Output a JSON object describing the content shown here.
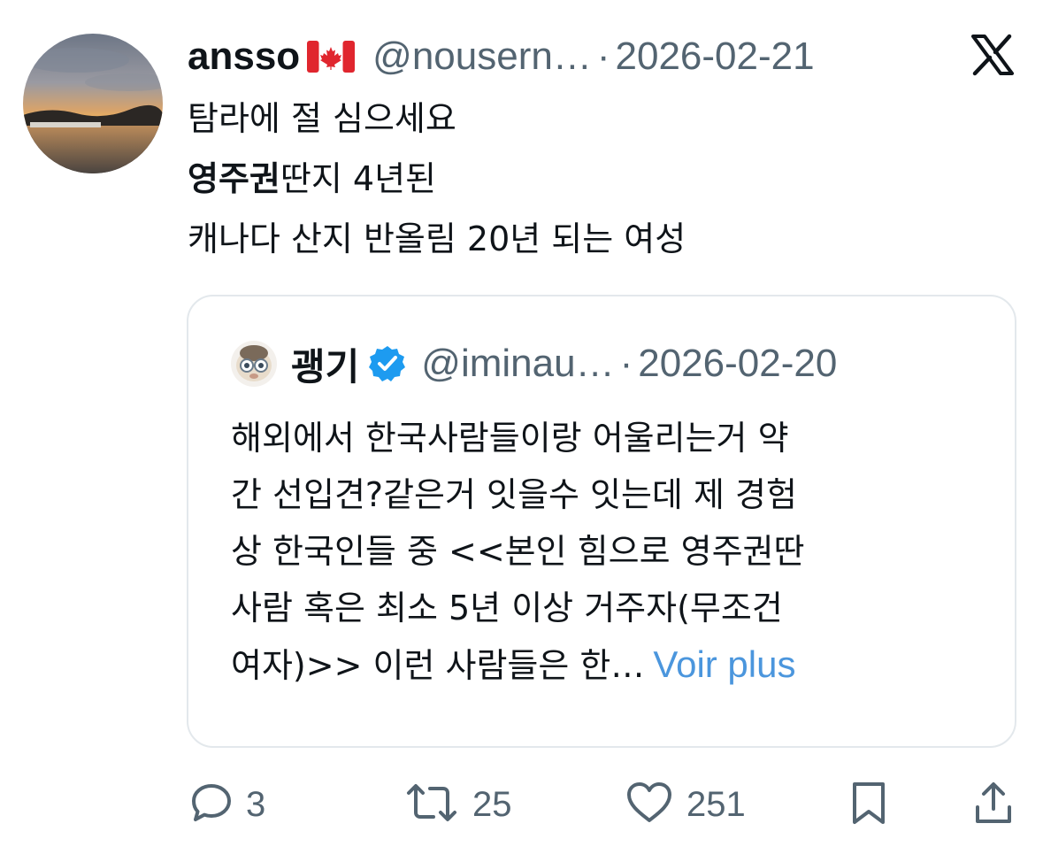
{
  "tweet": {
    "author_name": "ansso",
    "handle": "@nousern…",
    "date": "2026-02-21",
    "separator": "·",
    "flag_icon": "canada-flag-icon",
    "lines": [
      {
        "bold": "",
        "text": "탐라에 절 심으세요"
      },
      {
        "bold": "영주권",
        "text": "딴지 4년된"
      },
      {
        "bold": "",
        "text": "캐나다 산지 반올림 20년 되는 여성"
      }
    ]
  },
  "quote": {
    "author_name": "괭기",
    "handle": "@iminau…",
    "date": "2026-02-20",
    "separator": "·",
    "verified_icon": "verified-badge-icon",
    "lines": [
      "해외에서 한국사람들이랑 어울리는거 약",
      "간 선입견?같은거 잇을수 잇는데 제 경험",
      "상 한국인들 중 <<본인 힘으로 영주권딴",
      "사람 혹은 최소 5년 이상 거주자(무조건",
      "여자)>> 이런 사람들은 한…"
    ],
    "more_label": "Voir plus"
  },
  "actions": {
    "replies": "3",
    "reposts": "25",
    "likes": "251"
  },
  "colors": {
    "text": "#0f1419",
    "muted": "#536471",
    "link": "#4b96dd",
    "verified": "#1d9bf0",
    "border": "#e3e8ec"
  }
}
